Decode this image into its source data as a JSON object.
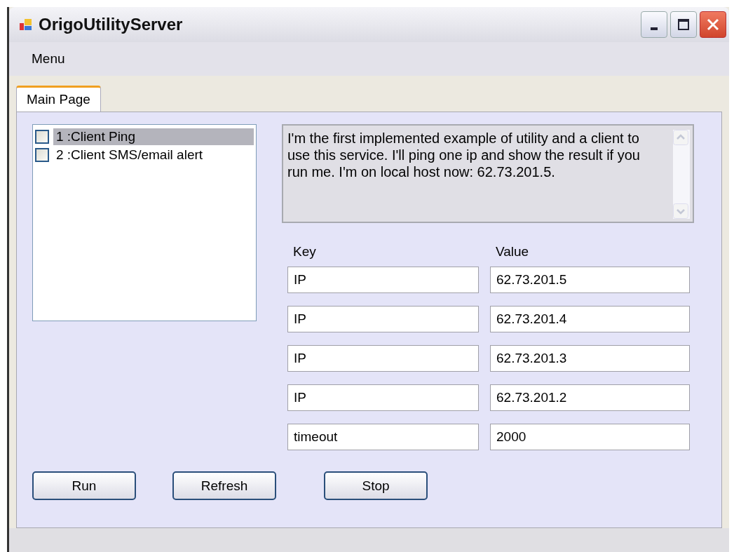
{
  "window": {
    "title": "OrigoUtilityServer"
  },
  "menu": [
    "Menu"
  ],
  "tabs": [
    {
      "label": "Main Page",
      "selected": true
    }
  ],
  "utilities": [
    {
      "label": "1 :Client Ping",
      "checked": false,
      "selected": true
    },
    {
      "label": "2 :Client SMS/email alert",
      "checked": false,
      "selected": false
    }
  ],
  "description": "I'm the first implemented example of utility and a client to use this service. I'll ping one ip and show the result if you run me. I'm on local host now: 62.73.201.5.",
  "parameters": {
    "columns": [
      "Key",
      "Value"
    ],
    "rows": [
      {
        "key": "IP",
        "value": "62.73.201.5"
      },
      {
        "key": "IP",
        "value": "62.73.201.4"
      },
      {
        "key": "IP",
        "value": "62.73.201.3"
      },
      {
        "key": "IP",
        "value": "62.73.201.2"
      },
      {
        "key": "timeout",
        "value": "2000"
      }
    ]
  },
  "buttons": [
    "Run",
    "Refresh",
    "Stop"
  ]
}
